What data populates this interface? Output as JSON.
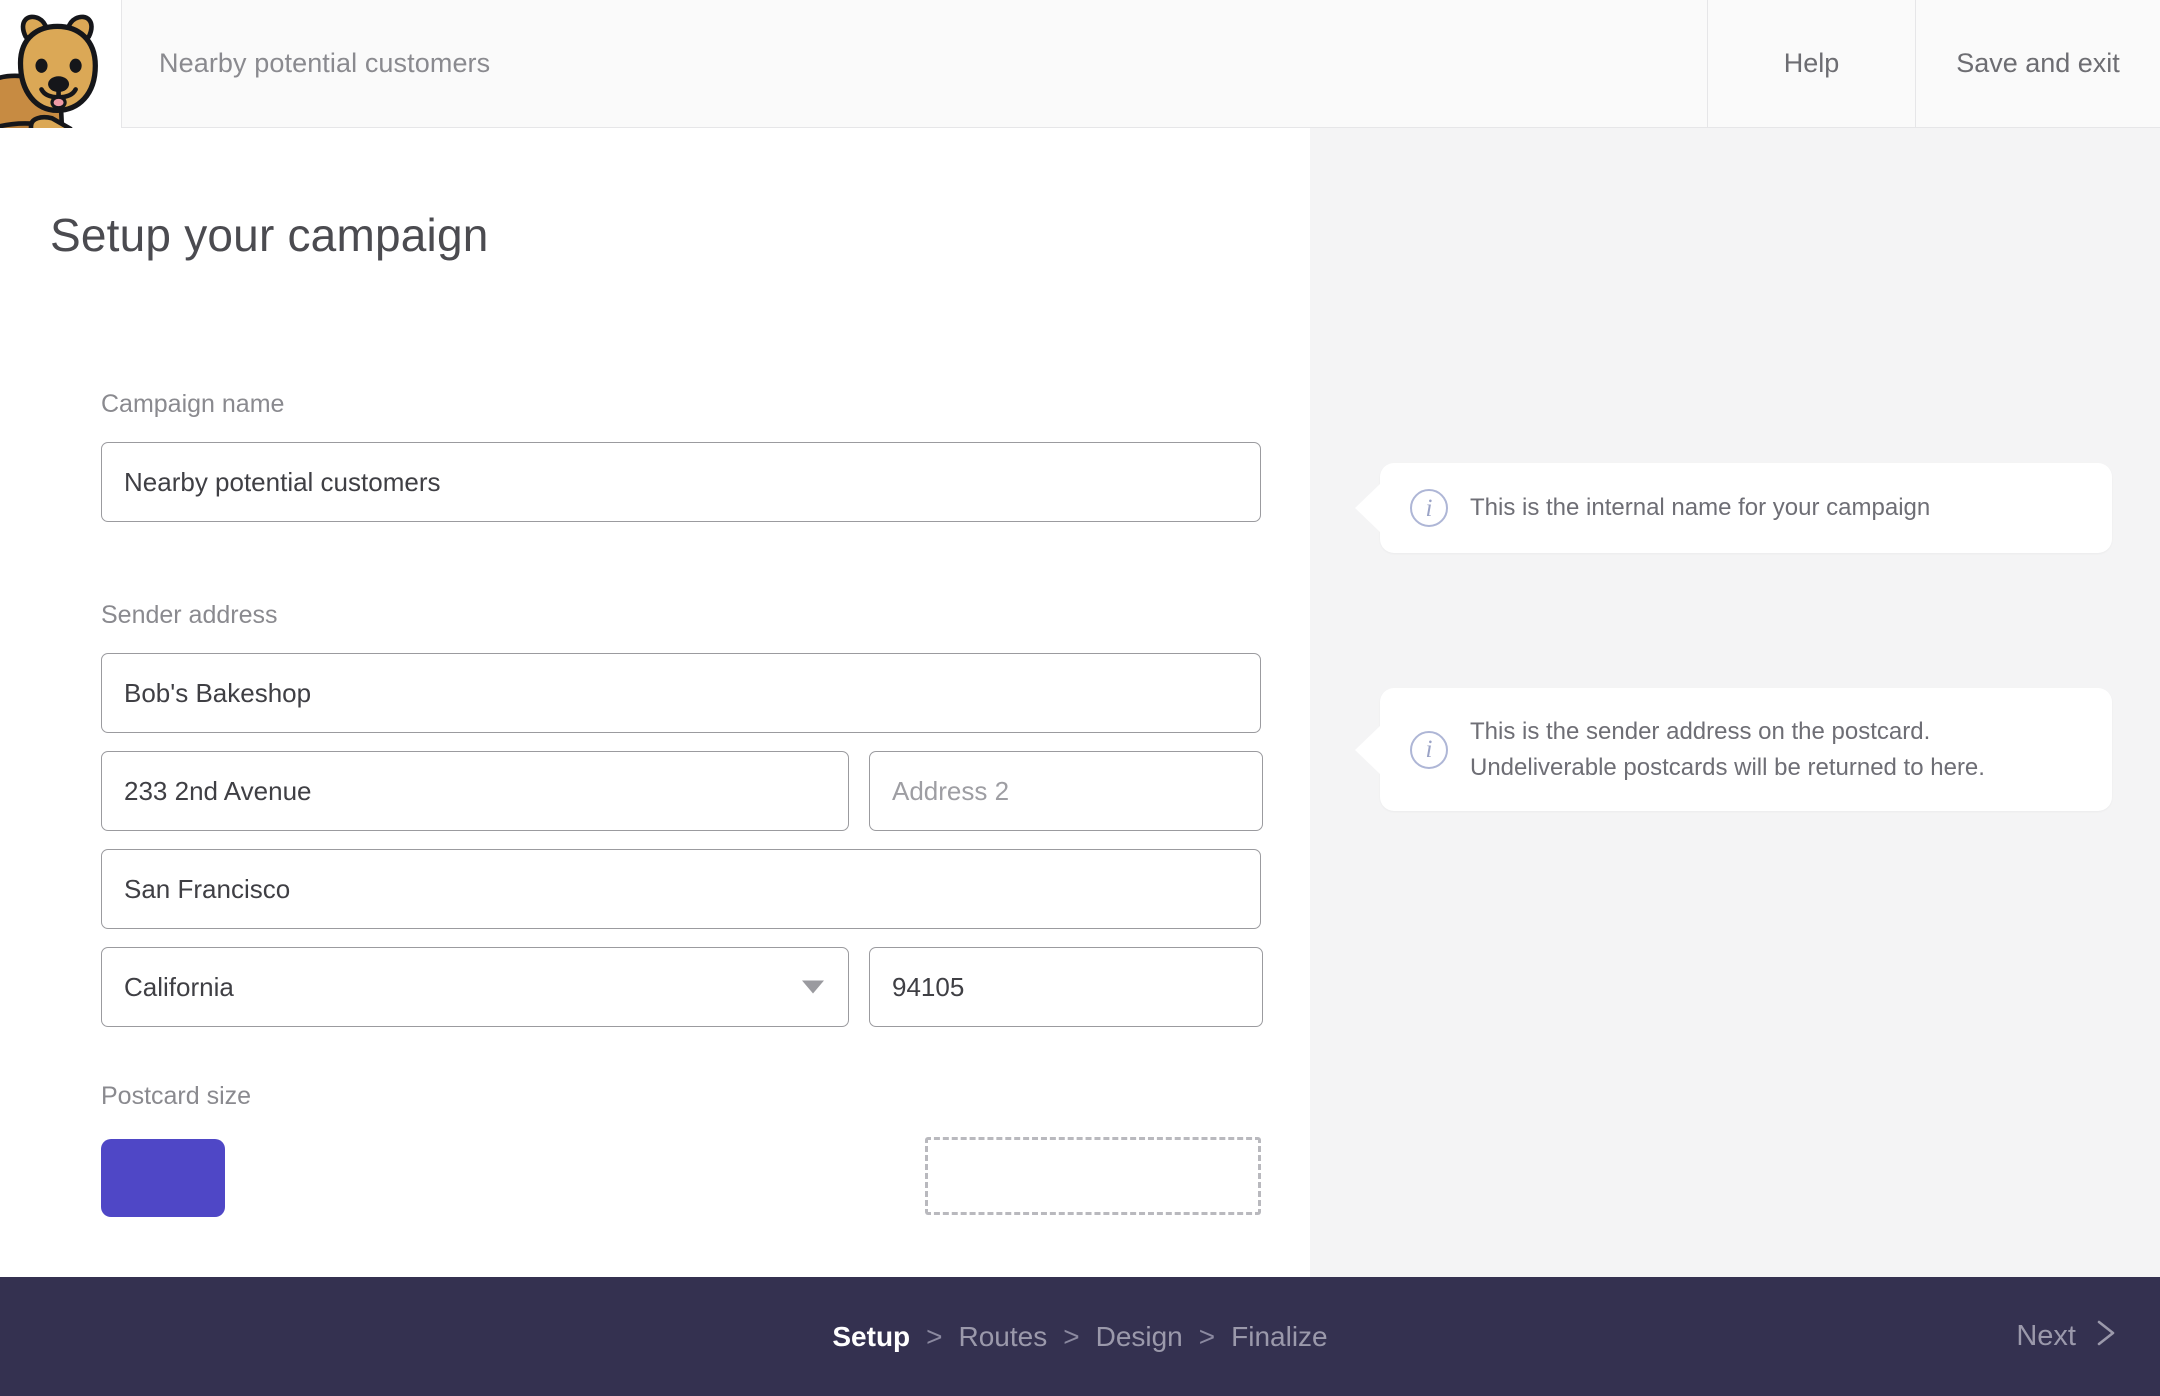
{
  "header": {
    "logo_icon": "quokka-logo",
    "title": "Nearby potential customers",
    "help_label": "Help",
    "save_exit_label": "Save and exit"
  },
  "main": {
    "page_title": "Setup your campaign",
    "campaign_name": {
      "label": "Campaign name",
      "value": "Nearby potential customers"
    },
    "sender_address": {
      "label": "Sender address",
      "company": "Bob's Bakeshop",
      "address1": "233 2nd Avenue",
      "address2_value": "",
      "address2_placeholder": "Address 2",
      "city": "San Francisco",
      "state": "California",
      "zip": "94105",
      "state_caret_icon": "chevron-down-icon"
    },
    "postcard_size": {
      "label": "Postcard size"
    }
  },
  "tooltips": [
    {
      "icon": "info-icon",
      "text": "This is the internal name for your campaign"
    },
    {
      "icon": "info-icon",
      "text": "This is the sender address on the postcard. Undeliverable postcards will be returned to here."
    }
  ],
  "footer": {
    "steps": [
      {
        "label": "Setup",
        "active": true
      },
      {
        "label": "Routes",
        "active": false
      },
      {
        "label": "Design",
        "active": false
      },
      {
        "label": "Finalize",
        "active": false
      }
    ],
    "separator": ">",
    "next_label": "Next",
    "next_icon": "chevron-right-icon"
  },
  "colors": {
    "footer_bg": "#343150",
    "accent_purple": "#4f47c6",
    "panel_bg": "#f4f4f5",
    "header_bg": "#fafafa",
    "info_icon": "#aeb6d6"
  }
}
